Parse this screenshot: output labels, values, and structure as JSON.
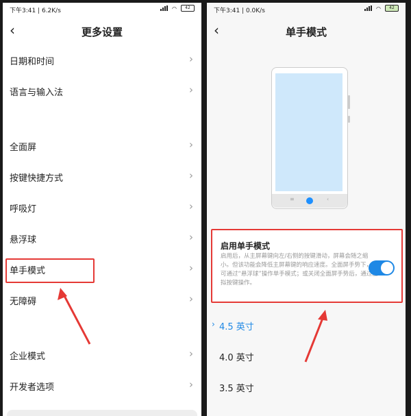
{
  "colors": {
    "accent": "#1e88e5",
    "annotation": "#e53935"
  },
  "left": {
    "status": {
      "time_net": "下午3:41 | 6.2K/s",
      "battery": "42"
    },
    "title": "更多设置",
    "back_icon": "back-chevron-icon",
    "items": [
      {
        "label": "日期和时间"
      },
      {
        "label": "语言与输入法"
      },
      {
        "label": "全面屏"
      },
      {
        "label": "按键快捷方式"
      },
      {
        "label": "呼吸灯"
      },
      {
        "label": "悬浮球"
      },
      {
        "label": "单手模式"
      },
      {
        "label": "无障碍"
      },
      {
        "label": "企业模式"
      },
      {
        "label": "开发者选项"
      }
    ]
  },
  "right": {
    "status": {
      "time_net": "下午3:41 | 0.0K/s",
      "battery": "42"
    },
    "title": "单手模式",
    "toggle": {
      "title": "启用单手模式",
      "description": "启用后，从主屏幕键向左/右侧的按键滑动，屏幕会随之缩小。但该功能会降低主屏幕键的响应速度。全面屏手势下，您可通过“悬浮球”操作单手模式；或关闭全面屏手势后，通过虚拟按键操作。",
      "enabled": true
    },
    "sizes": [
      {
        "label": "4.5 英寸",
        "selected": true
      },
      {
        "label": "4.0 英寸",
        "selected": false
      },
      {
        "label": "3.5 英寸",
        "selected": false
      }
    ]
  }
}
